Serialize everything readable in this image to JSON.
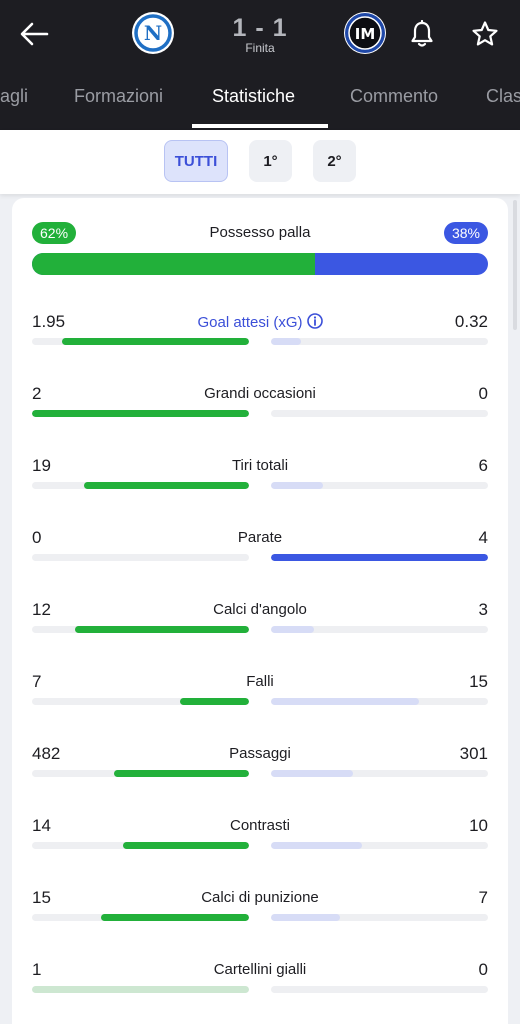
{
  "header": {
    "score": "1 - 1",
    "status": "Finita",
    "home_logo_letter": "N",
    "away_logo_letters": "IM"
  },
  "tabs": [
    {
      "label": "agli",
      "active": false
    },
    {
      "label": "Formazioni",
      "active": false
    },
    {
      "label": "Statistiche",
      "active": true
    },
    {
      "label": "Commento",
      "active": false
    },
    {
      "label": "Clas",
      "active": false
    }
  ],
  "periods": [
    {
      "label": "TUTTI",
      "active": true
    },
    {
      "label": "1°",
      "active": false
    },
    {
      "label": "2°",
      "active": false
    }
  ],
  "possession": {
    "label": "Possesso palla",
    "home_text": "62%",
    "away_text": "38%",
    "home": 62,
    "away": 38
  },
  "colors": {
    "home": "#22b03a",
    "away": "#3b57e2",
    "home_light": "#cde7d1",
    "away_light": "#d7dcf6",
    "header_bg": "#1d1d22"
  },
  "stats": [
    {
      "label": "Goal attesi (xG)",
      "home": "1.95",
      "away": "0.32",
      "link": true,
      "home_share": 0.86,
      "away_share": 0.14,
      "leader": "home"
    },
    {
      "label": "Grandi occasioni",
      "home": "2",
      "away": "0",
      "home_share": 1.0,
      "away_share": 0.0,
      "leader": "home"
    },
    {
      "label": "Tiri totali",
      "home": "19",
      "away": "6",
      "home_share": 0.76,
      "away_share": 0.24,
      "leader": "home"
    },
    {
      "label": "Parate",
      "home": "0",
      "away": "4",
      "home_share": 0.0,
      "away_share": 1.0,
      "leader": "away"
    },
    {
      "label": "Calci d'angolo",
      "home": "12",
      "away": "3",
      "home_share": 0.8,
      "away_share": 0.2,
      "leader": "home"
    },
    {
      "label": "Falli",
      "home": "7",
      "away": "15",
      "home_share": 0.32,
      "away_share": 0.68,
      "leader": "home"
    },
    {
      "label": "Passaggi",
      "home": "482",
      "away": "301",
      "home_share": 0.62,
      "away_share": 0.38,
      "leader": "home"
    },
    {
      "label": "Contrasti",
      "home": "14",
      "away": "10",
      "home_share": 0.58,
      "away_share": 0.42,
      "leader": "home"
    },
    {
      "label": "Calci di punizione",
      "home": "15",
      "away": "7",
      "home_share": 0.68,
      "away_share": 0.32,
      "leader": "home"
    },
    {
      "label": "Cartellini gialli",
      "home": "1",
      "away": "0",
      "home_share": 1.0,
      "away_share": 0.0,
      "leader": "neutral"
    }
  ]
}
